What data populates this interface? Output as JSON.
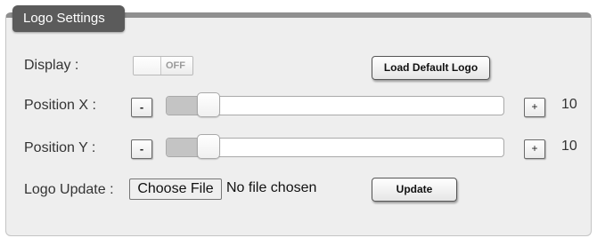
{
  "panel": {
    "title": "Logo Settings"
  },
  "display": {
    "label": "Display :",
    "toggle_text": "OFF",
    "load_default_label": "Load Default Logo"
  },
  "position_x": {
    "label": "Position X :",
    "minus_label": "-",
    "plus_label": "+",
    "value": "10",
    "slider_fraction": 0.1
  },
  "position_y": {
    "label": "Position Y :",
    "minus_label": "-",
    "plus_label": "+",
    "value": "10",
    "slider_fraction": 0.1
  },
  "logo_update": {
    "label": "Logo Update :",
    "choose_file_label": "Choose File",
    "file_status": "No file chosen",
    "update_label": "Update"
  },
  "colors": {
    "tab_background": "#5b5b5b",
    "panel_background": "#eeeeee"
  }
}
